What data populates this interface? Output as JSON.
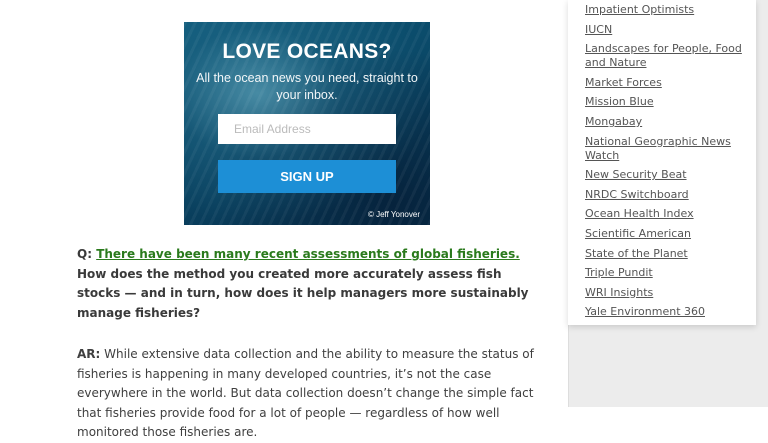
{
  "promo": {
    "title": "LOVE OCEANS?",
    "subtitle": "All the ocean news you need, straight to your inbox.",
    "email_placeholder": "Email Address",
    "button_label": "SIGN UP",
    "credit": "© Jeff Yonover"
  },
  "article": {
    "question_prefix": "Q:",
    "question_link": "There have been many recent assessments of global fisheries.",
    "question_rest": " How does the method you created more accurately assess fish stocks — and in turn, how does it help managers more sustainably manage fisheries?",
    "answer_prefix": "AR:",
    "answer_text": " While extensive data collection and the ability to measure the status of fisheries is happening in many developed countries, it’s not the case everywhere in the world. But data collection doesn’t change the simple fact that fisheries provide food for a lot of people — regardless of how well monitored those fisheries are."
  },
  "sidebar": {
    "links": [
      "Impatient Optimists",
      "IUCN",
      "Landscapes for People, Food and Nature",
      "Market Forces",
      "Mission Blue",
      "Mongabay",
      "National Geographic News Watch",
      "New Security Beat",
      "NRDC Switchboard",
      "Ocean Health Index",
      "Scientific American",
      "State of the Planet",
      "Triple Pundit",
      "WRI Insights",
      "Yale Environment 360"
    ]
  },
  "colors": {
    "link_green": "#2a7a1c",
    "button_blue": "#1d8fd6",
    "sidebar_bg": "#ececec"
  }
}
